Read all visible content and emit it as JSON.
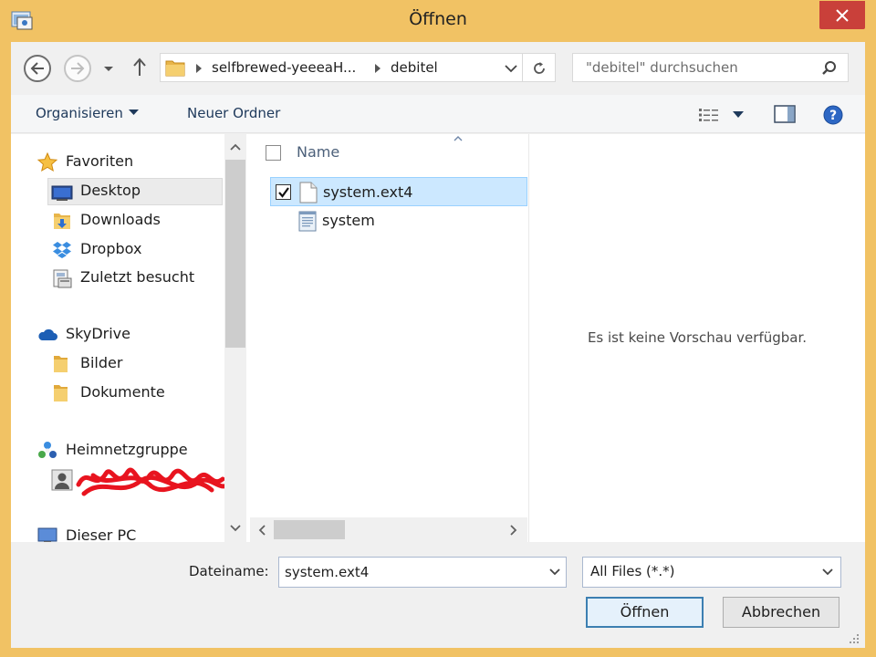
{
  "window": {
    "title": "Öffnen",
    "accent_color": "#f1c264",
    "close_color": "#c9403a"
  },
  "navigation": {
    "back_icon": "arrow-left-icon",
    "forward_icon": "arrow-right-icon",
    "up_icon": "arrow-up-icon",
    "address_segments": [
      "selfbrewed-yeeeaH...",
      "debitel"
    ],
    "search_placeholder": "\"debitel\" durchsuchen"
  },
  "toolbar": {
    "organize_label": "Organisieren",
    "new_folder_label": "Neuer Ordner"
  },
  "sidebar": {
    "items": [
      {
        "label": "Favoriten",
        "icon": "star-icon"
      },
      {
        "label": "Desktop",
        "icon": "desktop-icon",
        "selected": true
      },
      {
        "label": "Downloads",
        "icon": "downloads-folder-icon"
      },
      {
        "label": "Dropbox",
        "icon": "dropbox-icon"
      },
      {
        "label": "Zuletzt besucht",
        "icon": "recent-places-icon"
      },
      {
        "label": "SkyDrive",
        "icon": "cloud-icon"
      },
      {
        "label": "Bilder",
        "icon": "folder-icon"
      },
      {
        "label": "Dokumente",
        "icon": "folder-icon"
      },
      {
        "label": "Heimnetzgruppe",
        "icon": "homegroup-icon"
      },
      {
        "label": "Dieser PC",
        "icon": "computer-icon"
      }
    ]
  },
  "file_list": {
    "column_name": "Name",
    "files": [
      {
        "name": "system.ext4",
        "icon": "file-icon",
        "selected": true,
        "checked": true
      },
      {
        "name": "system",
        "icon": "text-file-icon",
        "selected": false,
        "checked": false
      }
    ]
  },
  "preview": {
    "text": "Es ist keine Vorschau verfügbar."
  },
  "footer": {
    "filename_label": "Dateiname:",
    "filename_value": "system.ext4",
    "filetype_value": "All Files (*.*)",
    "open_label": "Öffnen",
    "cancel_label": "Abbrechen"
  }
}
